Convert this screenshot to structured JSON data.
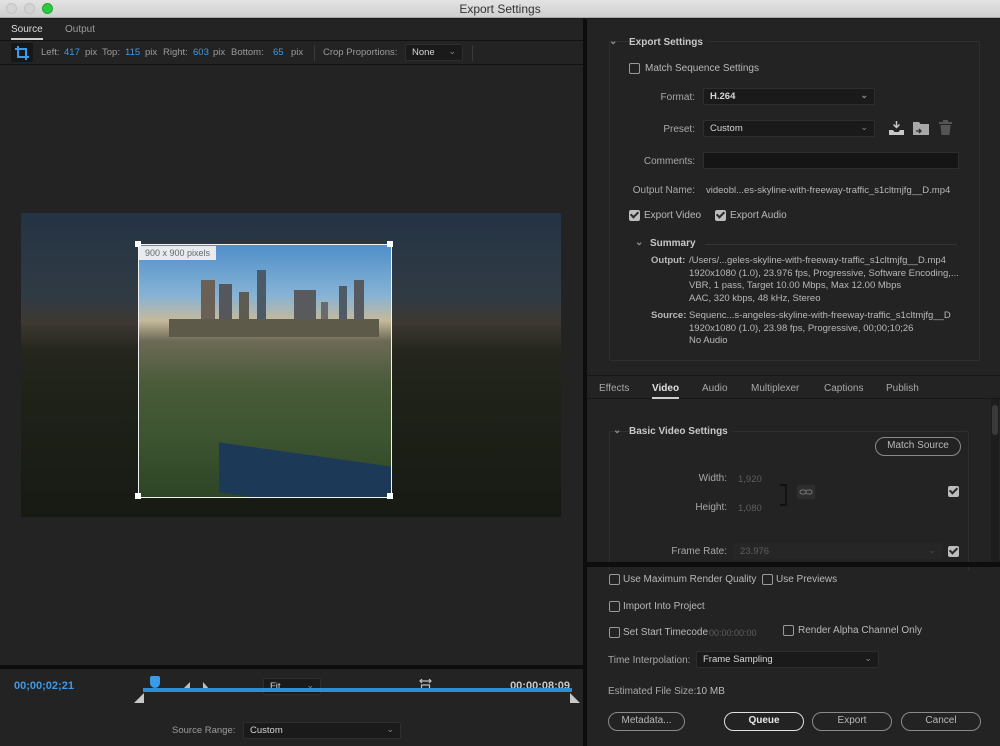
{
  "window": {
    "title": "Export Settings"
  },
  "source_panel": {
    "tabs": [
      {
        "label": "Source",
        "active": true
      },
      {
        "label": "Output",
        "active": false
      }
    ],
    "crop": {
      "left_label": "Left:",
      "left_value": "417",
      "top_label": "Top:",
      "top_value": "115",
      "right_label": "Right:",
      "right_value": "603",
      "bottom_label": "Bottom:",
      "bottom_value": "65",
      "unit": "pix",
      "proportions_label": "Crop Proportions:",
      "proportions_value": "None"
    },
    "crop_size_tag": "900 x 900 pixels",
    "timeline": {
      "current_time": "00;00;02;21",
      "end_time": "00;00;08;09",
      "zoom_value": "Fit",
      "source_range_label": "Source Range:",
      "source_range_value": "Custom",
      "playhead_position_fraction": 0.02
    }
  },
  "export_settings": {
    "section_title": "Export Settings",
    "match_sequence_label": "Match Sequence Settings",
    "match_sequence_checked": false,
    "format_label": "Format:",
    "format_value": "H.264",
    "preset_label": "Preset:",
    "preset_value": "Custom",
    "comments_label": "Comments:",
    "comments_value": "",
    "output_name_label": "Output Name:",
    "output_name_value": "videobl...es-skyline-with-freeway-traffic_s1cltmjfg__D.mp4",
    "export_video_label": "Export Video",
    "export_video_checked": true,
    "export_audio_label": "Export Audio",
    "export_audio_checked": true,
    "summary": {
      "title": "Summary",
      "output_label": "Output:",
      "output_lines": [
        "/Users/...geles-skyline-with-freeway-traffic_s1cltmjfg__D.mp4",
        "1920x1080 (1.0), 23.976 fps, Progressive, Software Encoding,...",
        "VBR, 1 pass, Target 10.00 Mbps, Max 12.00 Mbps",
        "AAC, 320 kbps, 48 kHz, Stereo"
      ],
      "source_label": "Source:",
      "source_lines": [
        "Sequenc...s-angeles-skyline-with-freeway-traffic_s1cltmjfg__D",
        "1920x1080 (1.0), 23.98 fps, Progressive, 00;00;10;26",
        "No Audio"
      ]
    }
  },
  "settings_tabs": [
    {
      "label": "Effects",
      "active": false
    },
    {
      "label": "Video",
      "active": true
    },
    {
      "label": "Audio",
      "active": false
    },
    {
      "label": "Multiplexer",
      "active": false
    },
    {
      "label": "Captions",
      "active": false
    },
    {
      "label": "Publish",
      "active": false
    }
  ],
  "basic_video": {
    "section_title": "Basic Video Settings",
    "match_source_label": "Match Source",
    "width_label": "Width:",
    "width_value": "1,920",
    "height_label": "Height:",
    "height_value": "1,080",
    "size_checked": true,
    "frame_rate_label": "Frame Rate:",
    "frame_rate_value": "23.976",
    "frame_rate_checked": true
  },
  "render_options": {
    "max_render_quality_label": "Use Maximum Render Quality",
    "max_render_quality_checked": false,
    "use_previews_label": "Use Previews",
    "use_previews_checked": false,
    "import_into_project_label": "Import Into Project",
    "import_into_project_checked": false,
    "set_start_timecode_label": "Set Start Timecode",
    "set_start_timecode_checked": false,
    "start_timecode_value": "00:00:00:00",
    "render_alpha_label": "Render Alpha Channel Only",
    "render_alpha_checked": false,
    "time_interpolation_label": "Time Interpolation:",
    "time_interpolation_value": "Frame Sampling",
    "estimated_size_label": "Estimated File Size:",
    "estimated_size_value": "10 MB"
  },
  "buttons": {
    "metadata": "Metadata...",
    "queue": "Queue",
    "export": "Export",
    "cancel": "Cancel"
  },
  "colors": {
    "accent_blue": "#3d9ae8",
    "track_blue": "#2a8fd6"
  }
}
